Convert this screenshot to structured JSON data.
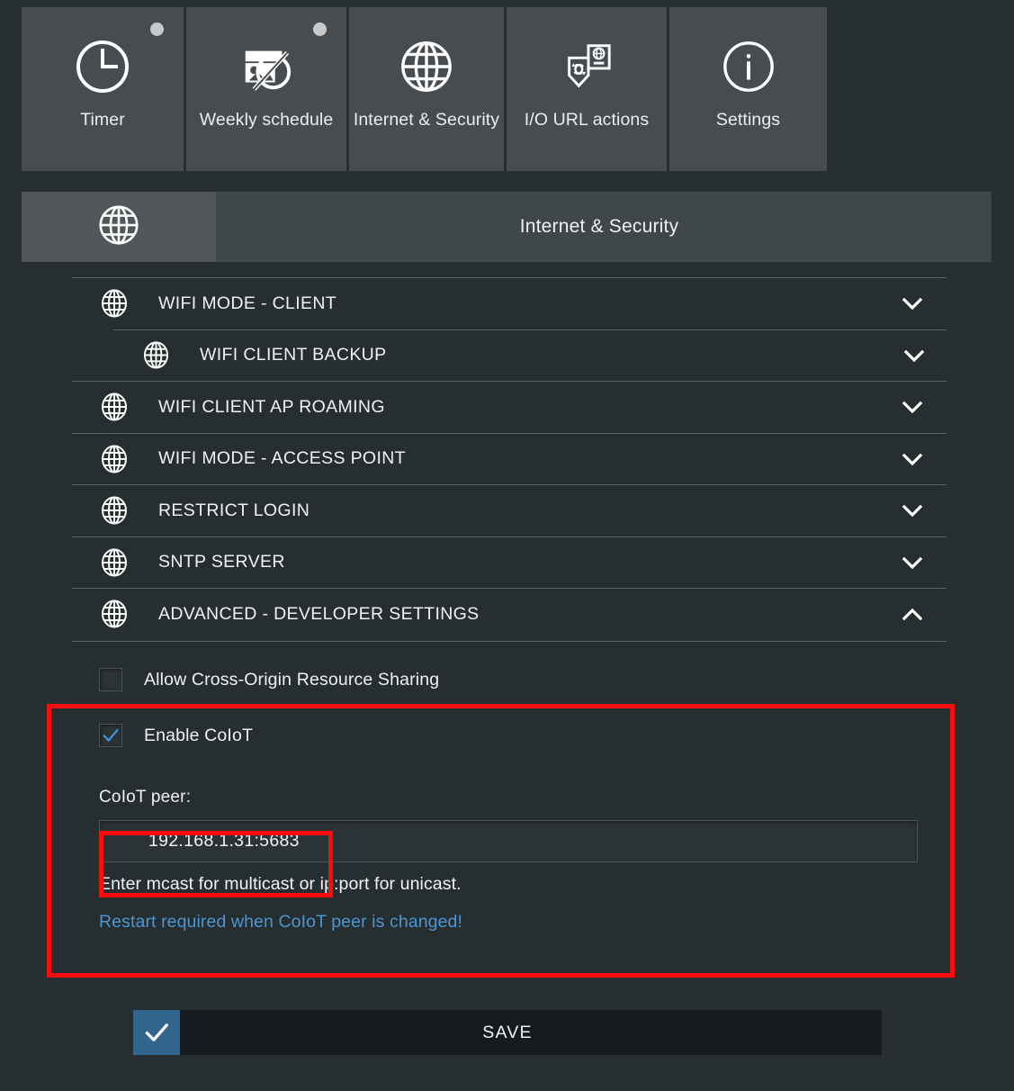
{
  "toolbar": {
    "tiles": [
      {
        "label": "Timer",
        "icon": "clock-icon",
        "has_dot": true
      },
      {
        "label": "Weekly schedule",
        "icon": "weekly-schedule-icon",
        "has_dot": true
      },
      {
        "label": "Internet & Security",
        "icon": "globe-icon",
        "has_dot": false
      },
      {
        "label": "I/O URL actions",
        "icon": "io-url-actions-icon",
        "has_dot": false
      },
      {
        "label": "Settings",
        "icon": "info-icon",
        "has_dot": false
      }
    ]
  },
  "section_header": {
    "icon": "globe-icon",
    "title": "Internet & Security"
  },
  "accordion": {
    "rows": [
      {
        "label": "WIFI MODE - CLIENT",
        "icon": "globe-icon",
        "chevron": "chevron-down-icon",
        "expanded": false,
        "nested": false
      },
      {
        "label": "WIFI CLIENT BACKUP",
        "icon": "globe-icon",
        "chevron": "chevron-down-icon",
        "expanded": false,
        "nested": true
      },
      {
        "label": "WIFI CLIENT AP ROAMING",
        "icon": "globe-icon",
        "chevron": "chevron-down-icon",
        "expanded": false,
        "nested": false
      },
      {
        "label": "WIFI MODE - ACCESS POINT",
        "icon": "globe-icon",
        "chevron": "chevron-down-icon",
        "expanded": false,
        "nested": false
      },
      {
        "label": "RESTRICT LOGIN",
        "icon": "globe-icon",
        "chevron": "chevron-down-icon",
        "expanded": false,
        "nested": false
      },
      {
        "label": "SNTP SERVER",
        "icon": "globe-icon",
        "chevron": "chevron-down-icon",
        "expanded": false,
        "nested": false
      },
      {
        "label": "ADVANCED - DEVELOPER SETTINGS",
        "icon": "globe-icon",
        "chevron": "chevron-up-icon",
        "expanded": true,
        "nested": false
      }
    ]
  },
  "advanced_panel": {
    "cors": {
      "label": "Allow Cross-Origin Resource Sharing",
      "checked": false
    },
    "coiot": {
      "label": "Enable CoIoT",
      "checked": true
    },
    "peer": {
      "label": "CoIoT peer:",
      "value": "192.168.1.31:5683",
      "placeholder": "",
      "hint": "Enter mcast for multicast or ip:port for unicast.",
      "restart_note": "Restart required when CoIoT peer is changed!"
    }
  },
  "save": {
    "label": "SAVE",
    "icon": "check-icon"
  },
  "colors": {
    "background": "#262e2f",
    "tile": "#474c50",
    "header_bar": "#3f474a",
    "header_iconbox": "#515659",
    "accent_blue": "#4d96d4",
    "save_blue": "#31668e",
    "annotation_red": "#fc0d0d",
    "text": "#eef2f5"
  },
  "annotations": [
    {
      "name": "coiot-section-highlight"
    },
    {
      "name": "coiot-peer-value-highlight"
    }
  ]
}
